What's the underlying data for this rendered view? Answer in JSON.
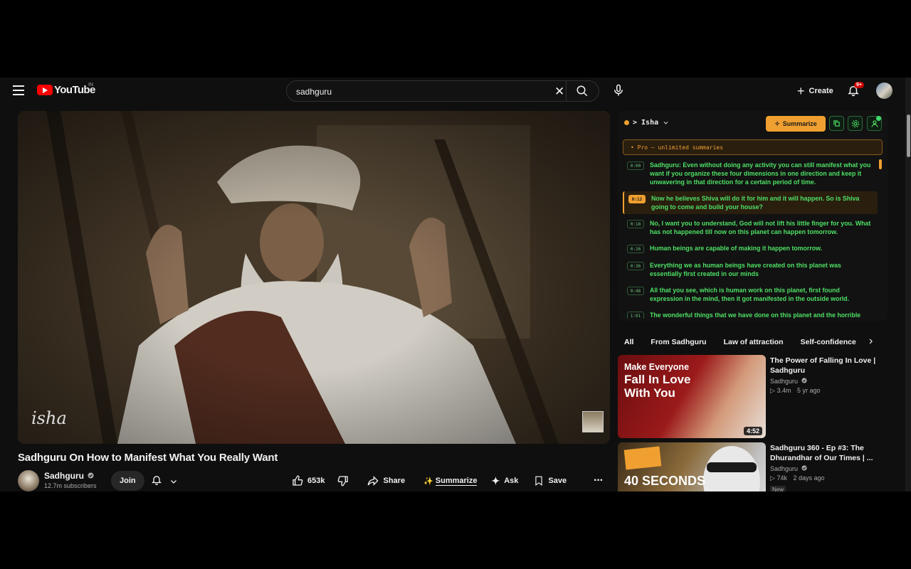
{
  "header": {
    "logo_text": "YouTube",
    "country_code": "IN",
    "search_value": "sadhguru",
    "create_label": "Create",
    "notification_count": "9+"
  },
  "video": {
    "title": "Sadhguru On How to Manifest What You Really Want",
    "watermark": "isha",
    "channel": {
      "name": "Sadhguru",
      "subscribers": "12.7m subscribers",
      "join_label": "Join"
    },
    "actions": {
      "likes": "653k",
      "share": "Share",
      "summarize": "Summarize",
      "ask": "Ask",
      "save": "Save"
    }
  },
  "extension": {
    "brand": "Isha",
    "summarize_label": "Summarize",
    "pro_banner": "• Pro — unlimited summaries",
    "transcript": [
      {
        "time": "0:00",
        "text": "Sadhguru: Even without doing any activity you can still manifest what you want if you organize these four dimensions in one direction and keep it unwavering in that direction for a certain period of time."
      },
      {
        "time": "0:12",
        "text": "Now he believes Shiva will do it for him and it will happen. So is Shiva going to come and build your house?",
        "active": true
      },
      {
        "time": "0:18",
        "text": "No, I want you to understand, God will not lift his little finger for you. What has not happened till now on this planet can happen tomorrow."
      },
      {
        "time": "0:26",
        "text": "Human beings are capable of making it happen tomorrow."
      },
      {
        "time": "0:36",
        "text": "Everything we as human beings have created on this planet was essentially first created in our minds"
      },
      {
        "time": "0:46",
        "text": "All that you see, which is human work on this planet, first found expression in the mind, then it got manifested in the outside world."
      },
      {
        "time": "1:01",
        "text": "The wonderful things that we have done on this planet and the horrible things that we have done on this planet both have come from the"
      }
    ]
  },
  "chips": [
    "All",
    "From Sadhguru",
    "Law of attraction",
    "Self-confidence"
  ],
  "recommendations": [
    {
      "title": "The Power of Falling In Love | Sadhguru",
      "channel": "Sadhguru",
      "views": "3.4m",
      "age": "5 yr ago",
      "duration": "4:52",
      "thumb_line1": "Make Everyone",
      "thumb_line2": "Fall In Love",
      "thumb_line3": "With You"
    },
    {
      "title": "Sadhguru 360 - Ep #3: The Dhurandhar of Our Times | ...",
      "channel": "Sadhguru",
      "views": "74k",
      "age": "2 days ago",
      "badge": "New",
      "thumb_line1": "40 SECONDS"
    }
  ],
  "colors": {
    "accent": "#f0a030",
    "transcript_text": "#4ee065",
    "brand_red": "#ff0000"
  }
}
